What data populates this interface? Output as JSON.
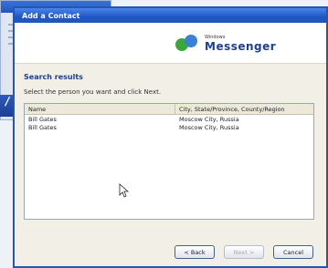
{
  "background_window": {},
  "dialog": {
    "title": "Add a Contact",
    "logo": {
      "small": "Windows",
      "big": "Messenger"
    },
    "section_title": "Search results",
    "instruction": "Select the person you want and click Next.",
    "table": {
      "headers": [
        "Name",
        "City, State/Province, County/Region"
      ],
      "rows": [
        {
          "name": "Bill Gates",
          "location": "Moscow City, Russia"
        },
        {
          "name": "Bill Gates",
          "location": "Moscow City, Russia"
        }
      ]
    },
    "buttons": {
      "back": "< Back",
      "next": "Next >",
      "cancel": "Cancel"
    }
  },
  "colors": {
    "titlebar": "#2456b8",
    "dialog_bg": "#f1efe6",
    "section_title": "#1b3f8c"
  }
}
